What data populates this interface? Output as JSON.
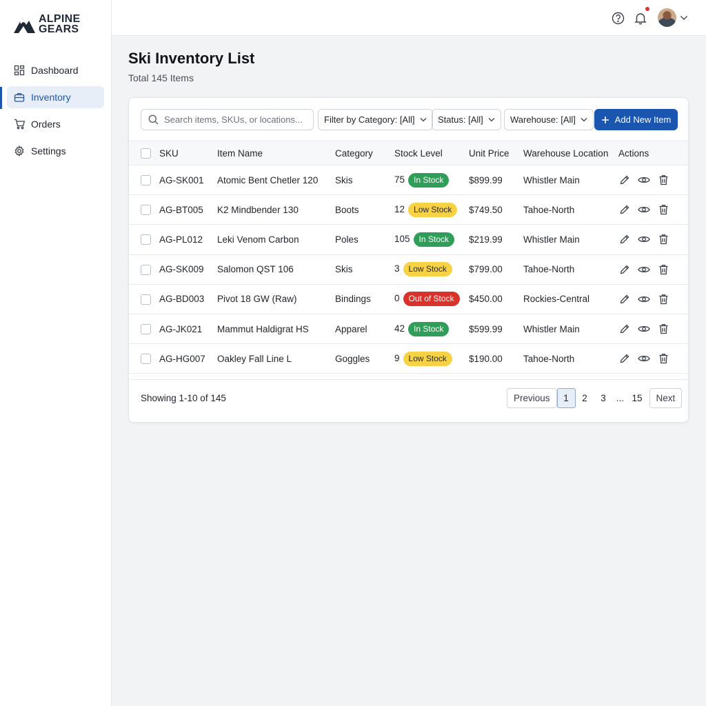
{
  "brand": {
    "line1": "ALPINE",
    "line2": "GEARS"
  },
  "sidebar": {
    "items": [
      {
        "label": "Dashboard",
        "icon": "dashboard-icon",
        "active": false
      },
      {
        "label": "Inventory",
        "icon": "briefcase-icon",
        "active": true
      },
      {
        "label": "Orders",
        "icon": "cart-icon",
        "active": false
      },
      {
        "label": "Settings",
        "icon": "gear-icon",
        "active": false
      }
    ]
  },
  "topbar": {
    "icons": [
      "help-icon",
      "bell-icon",
      "avatar",
      "chevron-down-icon"
    ]
  },
  "page": {
    "title": "Ski Inventory List",
    "subtitle": "Total 145 Items"
  },
  "toolbar": {
    "search_placeholder": "Search items, SKUs, or locations...",
    "filter_category": "Filter by Category: [All]",
    "filter_status": "Status: [All]",
    "filter_warehouse": "Warehouse: [All]",
    "add_label": "Add New Item"
  },
  "table": {
    "headers": [
      "SKU",
      "Item Name",
      "Category",
      "Stock Level",
      "Unit Price",
      "Warehouse Location",
      "Actions"
    ],
    "rows": [
      {
        "sku": "AG-SK001",
        "name": "Atomic Bent Chetler 120",
        "category": "Skis",
        "qty": "75",
        "status": "In Stock",
        "status_type": "in",
        "price": "$899.99",
        "warehouse": "Whistler Main"
      },
      {
        "sku": "AG-BT005",
        "name": "K2 Mindbender 130",
        "category": "Boots",
        "qty": "12",
        "status": "Low Stock",
        "status_type": "low",
        "price": "$749.50",
        "warehouse": "Tahoe-North"
      },
      {
        "sku": "AG-PL012",
        "name": "Leki Venom Carbon",
        "category": "Poles",
        "qty": "105",
        "status": "In Stock",
        "status_type": "in",
        "price": "$219.99",
        "warehouse": "Whistler Main"
      },
      {
        "sku": "AG-SK009",
        "name": "Salomon QST 106",
        "category": "Skis",
        "qty": "3",
        "status": "Low Stock",
        "status_type": "low",
        "price": "$799.00",
        "warehouse": "Tahoe-North"
      },
      {
        "sku": "AG-BD003",
        "name": "Pivot 18 GW (Raw)",
        "category": "Bindings",
        "qty": "0",
        "status": "Out of Stock",
        "status_type": "out",
        "price": "$450.00",
        "warehouse": "Rockies-Central"
      },
      {
        "sku": "AG-JK021",
        "name": "Mammut Haldigrat HS",
        "category": "Apparel",
        "qty": "42",
        "status": "In Stock",
        "status_type": "in",
        "price": "$599.99",
        "warehouse": "Whistler Main"
      },
      {
        "sku": "AG-HG007",
        "name": "Oakley Fall Line L",
        "category": "Goggles",
        "qty": "9",
        "status": "Low Stock",
        "status_type": "low",
        "price": "$190.00",
        "warehouse": "Tahoe-North"
      }
    ]
  },
  "footer": {
    "showing": "Showing 1-10 of 145",
    "previous": "Previous",
    "next": "Next",
    "pages": [
      "1",
      "2",
      "3"
    ],
    "ellipsis": "...",
    "last_page": "15",
    "current_page": "1"
  },
  "colors": {
    "accent": "#1a56b0",
    "in_stock": "#2f9e58",
    "low_stock": "#f6d244",
    "out_of_stock": "#d9322b"
  }
}
